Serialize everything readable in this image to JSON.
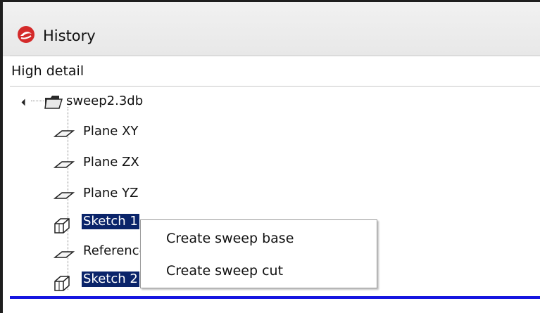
{
  "window": {
    "title": "History"
  },
  "dropdown": {
    "value": "High detail"
  },
  "tree": {
    "root": {
      "label": "sweep2.3db"
    },
    "items": [
      {
        "label": "Plane XY",
        "icon": "plane-icon",
        "selected": false
      },
      {
        "label": "Plane ZX",
        "icon": "plane-icon",
        "selected": false
      },
      {
        "label": "Plane YZ",
        "icon": "plane-icon",
        "selected": false
      },
      {
        "label": "Sketch 1",
        "icon": "sketch-icon",
        "selected": true
      },
      {
        "label": "Reference",
        "icon": "plane-icon",
        "selected": false
      },
      {
        "label": "Sketch 2",
        "icon": "sketch-icon",
        "selected": true
      }
    ]
  },
  "context_menu": {
    "items": [
      {
        "label": "Create sweep base"
      },
      {
        "label": "Create sweep cut"
      }
    ]
  },
  "colors": {
    "selection": "#0a246a",
    "accent_bar": "#1515e0"
  }
}
